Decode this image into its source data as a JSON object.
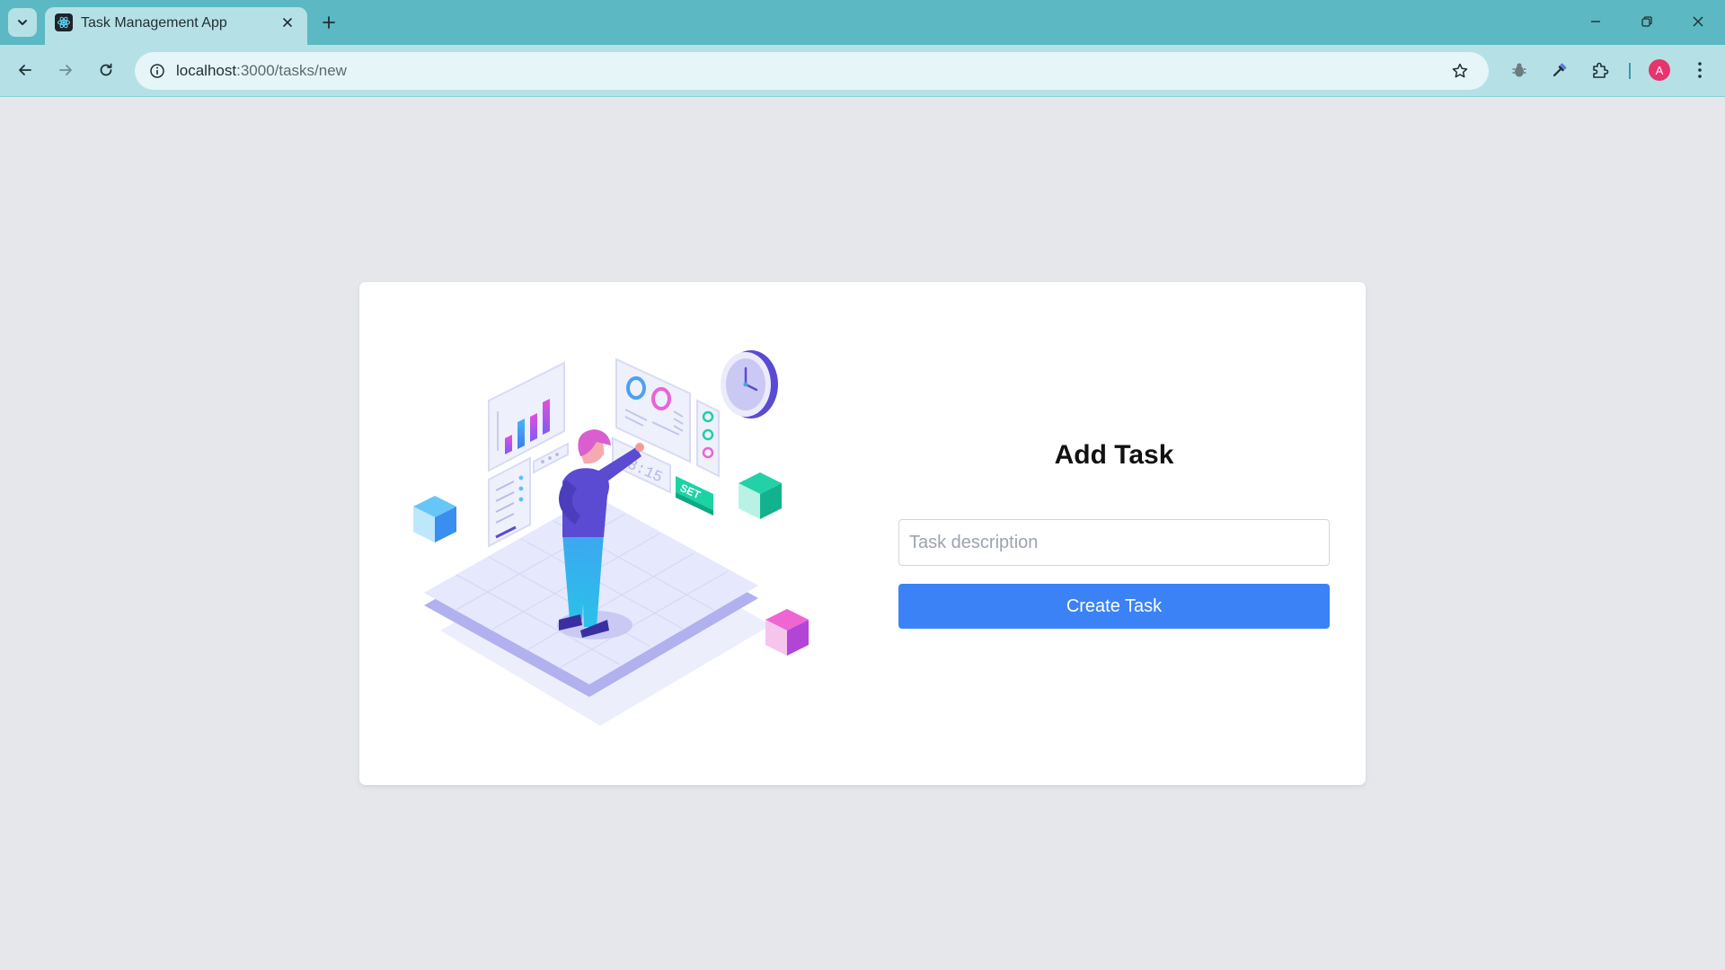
{
  "browser": {
    "tab_title": "Task Management App",
    "url_host": "localhost",
    "url_path": ":3000/tasks/new",
    "profile_initial": "A"
  },
  "illustration": {
    "clock_display": "08:15",
    "set_label": "SET"
  },
  "form": {
    "title": "Add Task",
    "input_value": "",
    "input_placeholder": "Task description",
    "submit_label": "Create Task"
  },
  "colors": {
    "page_background": "#e5e7eb",
    "tab_strip": "#5cb8c2",
    "toolbar": "#b5e1e6",
    "primary_button": "#3b82f6",
    "avatar": "#e8336d"
  },
  "icons": {
    "tab_search": "chevron-down-icon",
    "favicon": "react-icon",
    "tab_close": "close-icon",
    "new_tab": "plus-icon",
    "minimize": "minimize-icon",
    "restore": "restore-icon",
    "close_window": "close-icon",
    "back": "arrow-left-icon",
    "forward": "arrow-right-icon",
    "reload": "reload-icon",
    "site_info": "info-icon",
    "bookmark": "star-icon",
    "extension_1": "bug-icon",
    "extension_2": "eyedropper-icon",
    "extensions": "puzzle-icon",
    "menu": "more-vertical-icon"
  }
}
